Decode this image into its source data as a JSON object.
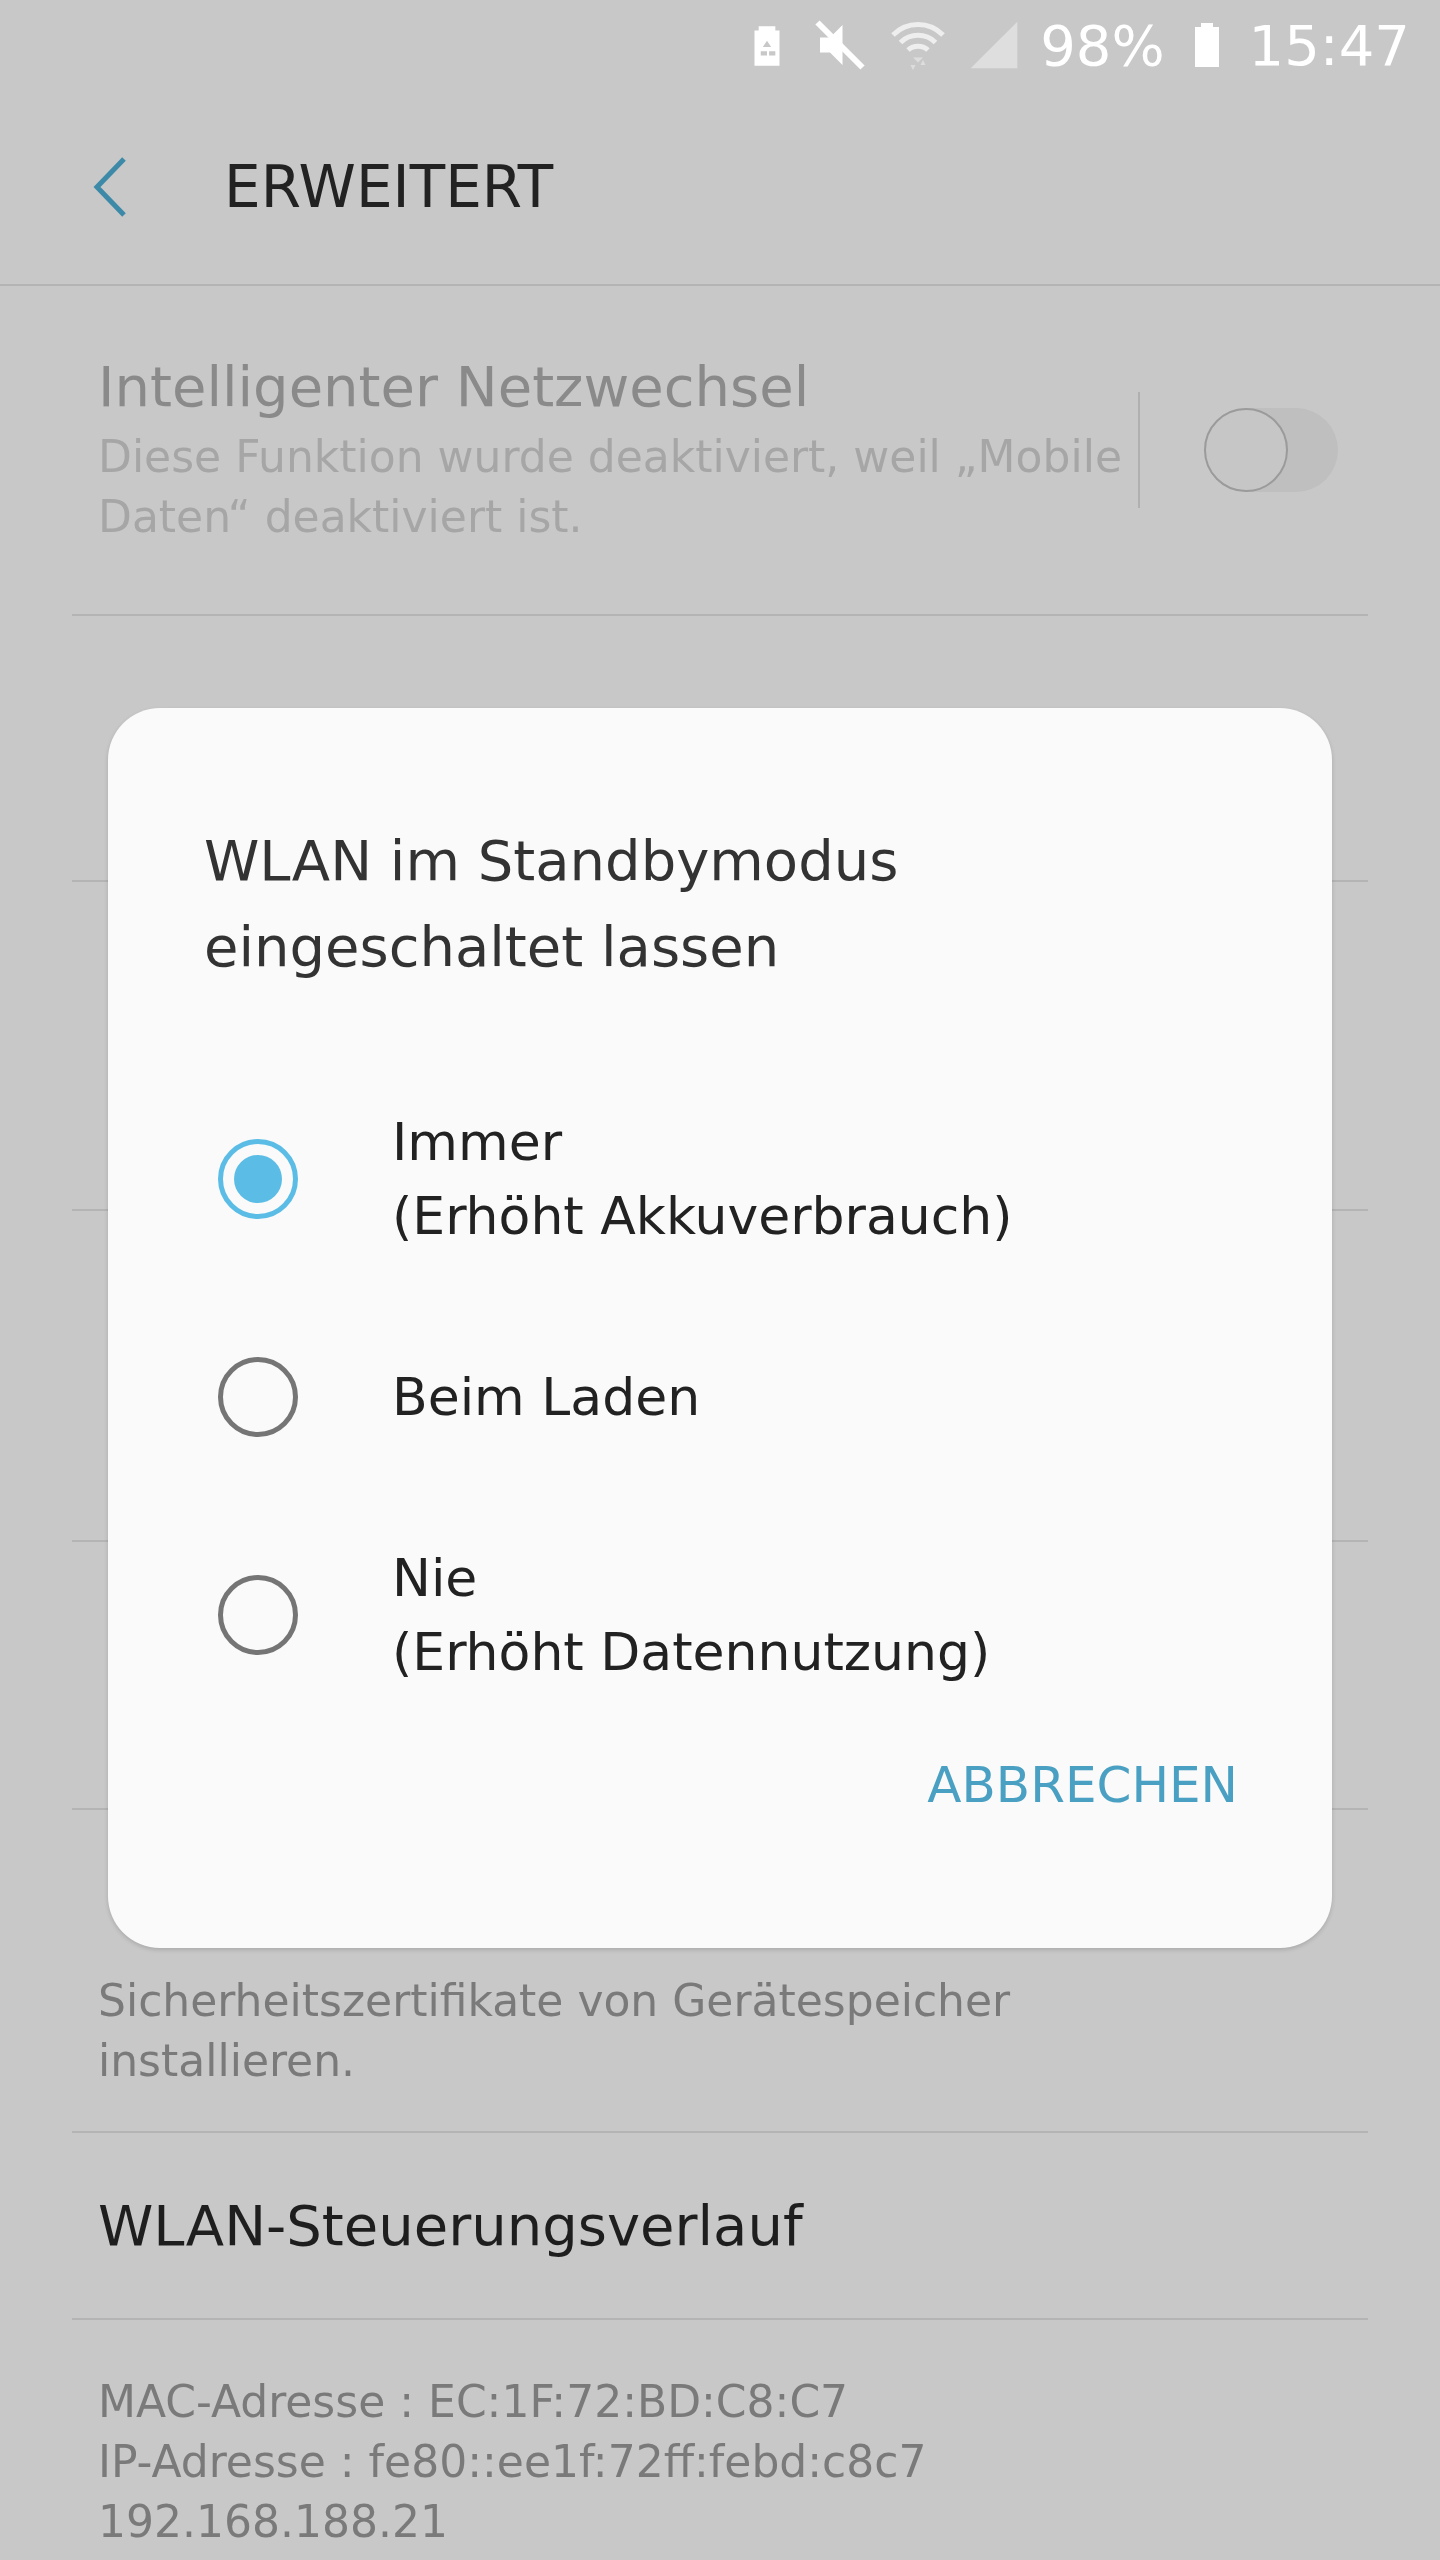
{
  "status_bar": {
    "battery_percent": "98%",
    "time": "15:47"
  },
  "header": {
    "title": "ERWEITERT"
  },
  "smart_network_switch": {
    "title": "Intelligenter Netzwechsel",
    "description": "Diese Funktion wurde deaktiviert, weil „Mobile Daten“ deaktiviert ist.",
    "on": false,
    "disabled": true
  },
  "certificates": {
    "description": "Sicherheitszertifikate von Gerätespeicher installieren."
  },
  "control_history": {
    "title": "WLAN-Steuerungsverlauf"
  },
  "info": [
    "MAC-Adresse : EC:1F:72:BD:C8:C7",
    "IP-Adresse : fe80::ee1f:72ff:febd:c8c7",
    "192.168.188.21"
  ],
  "dialog": {
    "title": "WLAN im Standbymodus eingeschaltet lassen",
    "options": [
      {
        "label": "Immer",
        "note": "(Erhöht Akkuverbrauch)",
        "selected": true
      },
      {
        "label": "Beim Laden",
        "selected": false
      },
      {
        "label": "Nie",
        "note": "(Erhöht Datennutzung)",
        "selected": false
      }
    ],
    "button": "ABBRECHEN"
  }
}
